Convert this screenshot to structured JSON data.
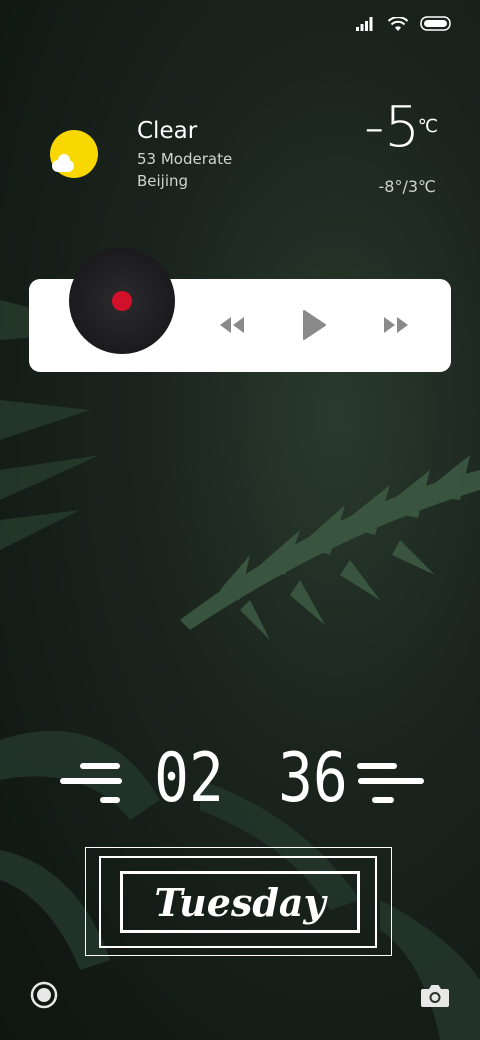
{
  "status_bar": {
    "icons": [
      "signal-icon",
      "wifi-icon",
      "battery-icon"
    ]
  },
  "weather": {
    "condition": "Clear",
    "aqi": "53  Moderate",
    "city": "Beijing",
    "temperature": "-5",
    "unit": "℃",
    "range": "-8°/3℃",
    "icon": "sun-cloud-icon",
    "colors": {
      "sun": "#f8d800"
    }
  },
  "music": {
    "controls": [
      "previous-icon",
      "play-icon",
      "next-icon"
    ],
    "colors": {
      "disc": "#1d1d20",
      "dot": "#d2102a",
      "panel": "#ffffff",
      "icon": "#888888"
    }
  },
  "clock": {
    "hour": "02",
    "minute": "36"
  },
  "day": {
    "label": "Tuesday"
  },
  "bottom": {
    "left_icon": "record-icon",
    "right_icon": "camera-icon"
  }
}
